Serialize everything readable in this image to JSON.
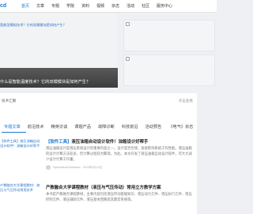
{
  "header": {
    "logo_text": "cd",
    "nav": [
      "首页",
      "文章",
      "专题",
      "学院",
      "资料",
      "视频",
      "杂志",
      "活动",
      "社区",
      "服务中心"
    ]
  },
  "hero": {
    "banner_text": "氢能型模拟技术？它的双模模块是如何产生？",
    "caption": "什么是智能温度技术？它的双模模块是如何产生？"
  },
  "panel": {
    "title": "技术汇聚",
    "more": "点击查看",
    "tabs": [
      "专题文章",
      "前沿技术",
      "精英访谈",
      "课题产品",
      "故障诊断",
      "科技前沿",
      "活动预告",
      "《电气》杂志"
    ]
  },
  "sidebar": [
    "【软件工具】液压油箱自动设计软件！油箱设计好帮手",
    "产教融合大学课程教材：液压与气压传动常用技术"
  ],
  "cards": [
    {
      "title_bracket": "【软件工具】",
      "title_rest": "液压油箱自动设计软件！油箱设计好帮手",
      "summary": "液压油箱设计是液压系统设计的重要内容之一，设计是否合理，直接影响系统工作性能。液压油箱的设计计算方法较多，但计算过程较为繁琐，为此，本文开发了液压油箱自动设计软件，可大大减少设计计算工作量。",
      "author": "Hydraulics&Hardware",
      "date": "2023年6月14日"
    },
    {
      "title_bracket": "",
      "title_rest": "产教融合大学课程教材（液压与气压传动）常用立方教学方案",
      "summary": "本书是产教融合课程教材，主要内容包括液压传动基础知识、液压动力元件、液压执行元件、液压控制元件、液压辅助元件、液压基本回路及其典型系统等。"
    }
  ]
}
